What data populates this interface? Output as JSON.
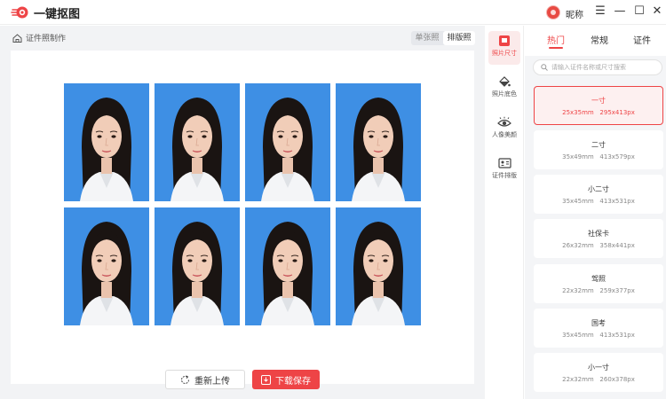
{
  "app": {
    "title": "一键抠图",
    "nickname": "昵称"
  },
  "window_controls": {
    "menu": "☰",
    "minimize": "—",
    "maximize": "☐",
    "close": "✕"
  },
  "breadcrumb": {
    "label": "证件照制作",
    "icon": "home-back-icon"
  },
  "mode_tabs": [
    {
      "label": "单张照"
    },
    {
      "label": "排版照",
      "active": true
    }
  ],
  "photo_sheet": {
    "background_color": "#3e8fe4",
    "count": 8
  },
  "actions": {
    "reupload": "重新上传",
    "download": "下载保存"
  },
  "rail": [
    {
      "label": "照片尺寸",
      "icon": "photo-size-icon",
      "active": true
    },
    {
      "label": "照片底色",
      "icon": "paint-bucket-icon"
    },
    {
      "label": "人像美颜",
      "icon": "eye-beauty-icon"
    },
    {
      "label": "证件排版",
      "icon": "id-layout-icon"
    }
  ],
  "categories": [
    {
      "label": "热门",
      "active": true
    },
    {
      "label": "常规"
    },
    {
      "label": "证件"
    }
  ],
  "search": {
    "placeholder": "请输入证件名称或尺寸搜索"
  },
  "sizes": [
    {
      "name": "一寸",
      "mm": "25x35mm",
      "px": "295x413px",
      "selected": true
    },
    {
      "name": "二寸",
      "mm": "35x49mm",
      "px": "413x579px"
    },
    {
      "name": "小二寸",
      "mm": "35x45mm",
      "px": "413x531px"
    },
    {
      "name": "社保卡",
      "mm": "26x32mm",
      "px": "358x441px"
    },
    {
      "name": "驾照",
      "mm": "22x32mm",
      "px": "259x377px"
    },
    {
      "name": "国考",
      "mm": "35x45mm",
      "px": "413x531px"
    },
    {
      "name": "小一寸",
      "mm": "22x32mm",
      "px": "260x378px"
    }
  ],
  "colors": {
    "accent": "#ee4446",
    "photo_bg": "#3e8fe4"
  }
}
